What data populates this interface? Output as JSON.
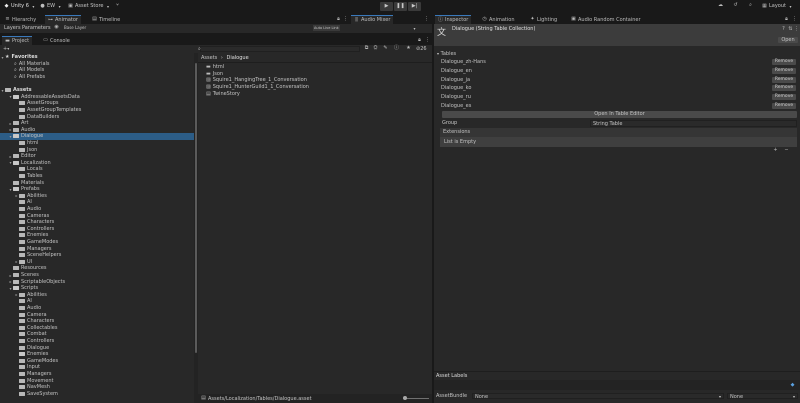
{
  "topbar": {
    "account": "Unity 6",
    "user": "EW",
    "store": "Asset Store",
    "layout": "Layout"
  },
  "left_top": {
    "tabs": [
      "Hierarchy",
      "Animator",
      "Timeline"
    ],
    "sub_tabs": [
      "Layers",
      "Parameters"
    ],
    "breadcrumb": "Base Layer",
    "auto_live": "Auto Live Link"
  },
  "mixer": {
    "tab": "Audio Mixer"
  },
  "project": {
    "tabs": [
      "Project",
      "Console"
    ],
    "count": "26",
    "favorites_label": "Favorites",
    "favorites": [
      "All Materials",
      "All Models",
      "All Prefabs"
    ],
    "assets_label": "Assets",
    "tree": [
      {
        "label": "AddressableAssetsData",
        "depth": 1,
        "arrow": "▾",
        "open": true
      },
      {
        "label": "AssetGroups",
        "depth": 2,
        "arrow": "",
        "open": false
      },
      {
        "label": "AssetGroupTemplates",
        "depth": 2,
        "arrow": "",
        "open": false
      },
      {
        "label": "DataBuilders",
        "depth": 2,
        "arrow": "",
        "open": false
      },
      {
        "label": "Art",
        "depth": 1,
        "arrow": "▸",
        "open": false
      },
      {
        "label": "Audio",
        "depth": 1,
        "arrow": "▸",
        "open": false
      },
      {
        "label": "Dialogue",
        "depth": 1,
        "arrow": "▾",
        "open": true,
        "selected": true
      },
      {
        "label": "html",
        "depth": 2,
        "arrow": "",
        "open": false
      },
      {
        "label": "Json",
        "depth": 2,
        "arrow": "",
        "open": false
      },
      {
        "label": "Editor",
        "depth": 1,
        "arrow": "▸",
        "open": false
      },
      {
        "label": "Localization",
        "depth": 1,
        "arrow": "▾",
        "open": true
      },
      {
        "label": "Locals",
        "depth": 2,
        "arrow": "",
        "open": false
      },
      {
        "label": "Tables",
        "depth": 2,
        "arrow": "",
        "open": false
      },
      {
        "label": "Materials",
        "depth": 1,
        "arrow": "",
        "open": false
      },
      {
        "label": "Prefabs",
        "depth": 1,
        "arrow": "▾",
        "open": true
      },
      {
        "label": "Abilities",
        "depth": 2,
        "arrow": "▸",
        "open": false
      },
      {
        "label": "AI",
        "depth": 2,
        "arrow": "",
        "open": false
      },
      {
        "label": "Audio",
        "depth": 2,
        "arrow": "",
        "open": false
      },
      {
        "label": "Cameras",
        "depth": 2,
        "arrow": "",
        "open": false
      },
      {
        "label": "Characters",
        "depth": 2,
        "arrow": "",
        "open": false
      },
      {
        "label": "Controllers",
        "depth": 2,
        "arrow": "",
        "open": false
      },
      {
        "label": "Enemies",
        "depth": 2,
        "arrow": "",
        "open": false
      },
      {
        "label": "GameModes",
        "depth": 2,
        "arrow": "",
        "open": false
      },
      {
        "label": "Managers",
        "depth": 2,
        "arrow": "",
        "open": false
      },
      {
        "label": "SceneHelpers",
        "depth": 2,
        "arrow": "",
        "open": false
      },
      {
        "label": "UI",
        "depth": 2,
        "arrow": "▸",
        "open": false
      },
      {
        "label": "Resources",
        "depth": 1,
        "arrow": "",
        "open": false
      },
      {
        "label": "Scenes",
        "depth": 1,
        "arrow": "▸",
        "open": false
      },
      {
        "label": "ScriptableObjects",
        "depth": 1,
        "arrow": "▸",
        "open": false
      },
      {
        "label": "Scripts",
        "depth": 1,
        "arrow": "▾",
        "open": true
      },
      {
        "label": "Abilities",
        "depth": 2,
        "arrow": "▸",
        "open": false
      },
      {
        "label": "AI",
        "depth": 2,
        "arrow": "",
        "open": false
      },
      {
        "label": "Audio",
        "depth": 2,
        "arrow": "",
        "open": false
      },
      {
        "label": "Camera",
        "depth": 2,
        "arrow": "",
        "open": false
      },
      {
        "label": "Characters",
        "depth": 2,
        "arrow": "",
        "open": false
      },
      {
        "label": "Collectables",
        "depth": 2,
        "arrow": "",
        "open": false
      },
      {
        "label": "Combat",
        "depth": 2,
        "arrow": "",
        "open": false
      },
      {
        "label": "Controllers",
        "depth": 2,
        "arrow": "",
        "open": false
      },
      {
        "label": "Dialogue",
        "depth": 2,
        "arrow": "",
        "open": false
      },
      {
        "label": "Enemies",
        "depth": 2,
        "arrow": "",
        "open": true
      },
      {
        "label": "GameModes",
        "depth": 2,
        "arrow": "",
        "open": false
      },
      {
        "label": "Input",
        "depth": 2,
        "arrow": "",
        "open": false
      },
      {
        "label": "Managers",
        "depth": 2,
        "arrow": "",
        "open": false
      },
      {
        "label": "Movement",
        "depth": 2,
        "arrow": "",
        "open": false
      },
      {
        "label": "NavMesh",
        "depth": 2,
        "arrow": "",
        "open": false
      },
      {
        "label": "SaveSystem",
        "depth": 2,
        "arrow": "",
        "open": false
      }
    ],
    "breadcrumb": [
      "Assets",
      "Dialogue"
    ],
    "files": [
      {
        "label": "html",
        "kind": "folder"
      },
      {
        "label": "Json",
        "kind": "folder"
      },
      {
        "label": "Squire1_HangingTree_1_Conversation",
        "kind": "asset"
      },
      {
        "label": "Squire1_HunterGuild1_1_Conversation",
        "kind": "asset"
      },
      {
        "label": "TwineStory",
        "kind": "doc"
      }
    ],
    "status_path": "Assets/Localization/Tables/Dialogue.asset"
  },
  "inspector": {
    "tabs": [
      "Inspector",
      "Animation",
      "Lighting",
      "Audio Random Container"
    ],
    "title": "Dialogue (String Table Collection)",
    "open_label": "Open",
    "tables_label": "Tables",
    "tables": [
      "Dialogue_zh-Hans",
      "Dialogue_en",
      "Dialogue_ja",
      "Dialogue_ko",
      "Dialogue_ru",
      "Dialogue_es"
    ],
    "remove_label": "Remove",
    "open_table_editor": "Open In Table Editor",
    "group_label": "Group",
    "group_value": "String Table",
    "extensions_label": "Extensions",
    "list_empty": "List is Empty",
    "asset_labels": "Asset Labels",
    "asset_bundle_label": "AssetBundle",
    "asset_bundle_value": "None",
    "asset_variant_value": "None"
  }
}
